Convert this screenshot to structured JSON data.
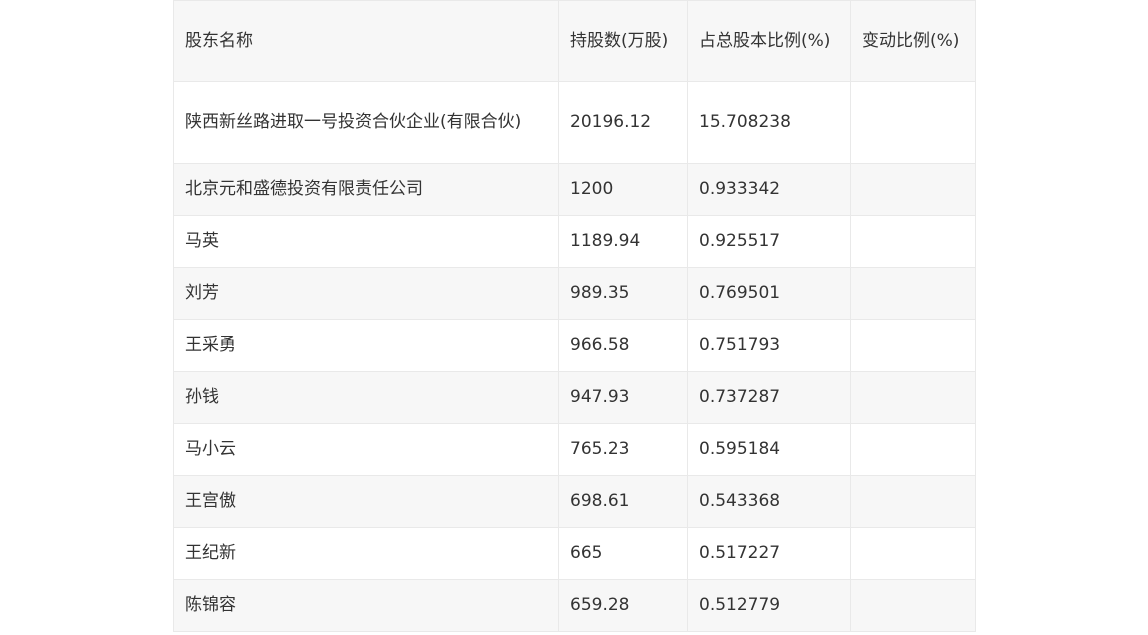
{
  "table": {
    "headers": [
      "股东名称",
      "持股数(万股)",
      "占总股本比例(%)",
      "变动比例(%)"
    ],
    "rows": [
      [
        "陕西新丝路进取一号投资合伙企业(有限合伙)",
        "20196.12",
        "15.708238",
        ""
      ],
      [
        "北京元和盛德投资有限责任公司",
        "1200",
        "0.933342",
        ""
      ],
      [
        "马英",
        "1189.94",
        "0.925517",
        ""
      ],
      [
        "刘芳",
        "989.35",
        "0.769501",
        ""
      ],
      [
        "王采勇",
        "966.58",
        "0.751793",
        ""
      ],
      [
        "孙钱",
        "947.93",
        "0.737287",
        ""
      ],
      [
        "马小云",
        "765.23",
        "0.595184",
        ""
      ],
      [
        "王宫傲",
        "698.61",
        "0.543368",
        ""
      ],
      [
        "王纪新",
        "665",
        "0.517227",
        ""
      ],
      [
        "陈锦容",
        "659.28",
        "0.512779",
        ""
      ]
    ]
  }
}
